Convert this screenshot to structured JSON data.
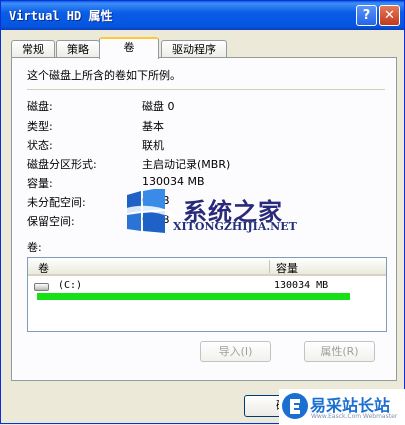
{
  "window": {
    "title": "Virtual HD 属性",
    "help_label": "?",
    "close_label": "✕"
  },
  "tabs": [
    {
      "label": "常规",
      "active": false
    },
    {
      "label": "策略",
      "active": false
    },
    {
      "label": "卷",
      "active": true
    },
    {
      "label": "驱动程序",
      "active": false
    }
  ],
  "panel": {
    "description": "这个磁盘上所含的卷如下所例。",
    "properties": [
      {
        "label": "磁盘:",
        "value": "磁盘 0"
      },
      {
        "label": "类型:",
        "value": "基本"
      },
      {
        "label": "状态:",
        "value": "联机"
      },
      {
        "label": "磁盘分区形式:",
        "value": "主启动记录(MBR)"
      },
      {
        "label": "容量:",
        "value": "130034 MB"
      },
      {
        "label": "未分配空间:",
        "value": "0 MB"
      },
      {
        "label": "保留空间:",
        "value": "0 MB"
      }
    ],
    "volumes_label": "卷:",
    "columns": [
      "卷",
      "容量"
    ],
    "rows": [
      {
        "name": "(C:)",
        "capacity": "130034 MB"
      }
    ],
    "import_button": "导入(I)",
    "properties_button": "属性(R)"
  },
  "footer": {
    "ok_button": "确"
  },
  "watermark": {
    "cn": "系统之家",
    "en": "XITONGZHIJIA.NET"
  },
  "corner_brand": {
    "name": "易采站长站",
    "sub": "Www.Easck.Com  Webmaster"
  },
  "colors": {
    "titlebar": "#0a5de7",
    "highlight_bar": "#18e018",
    "tab_accent": "#ffc83c"
  }
}
